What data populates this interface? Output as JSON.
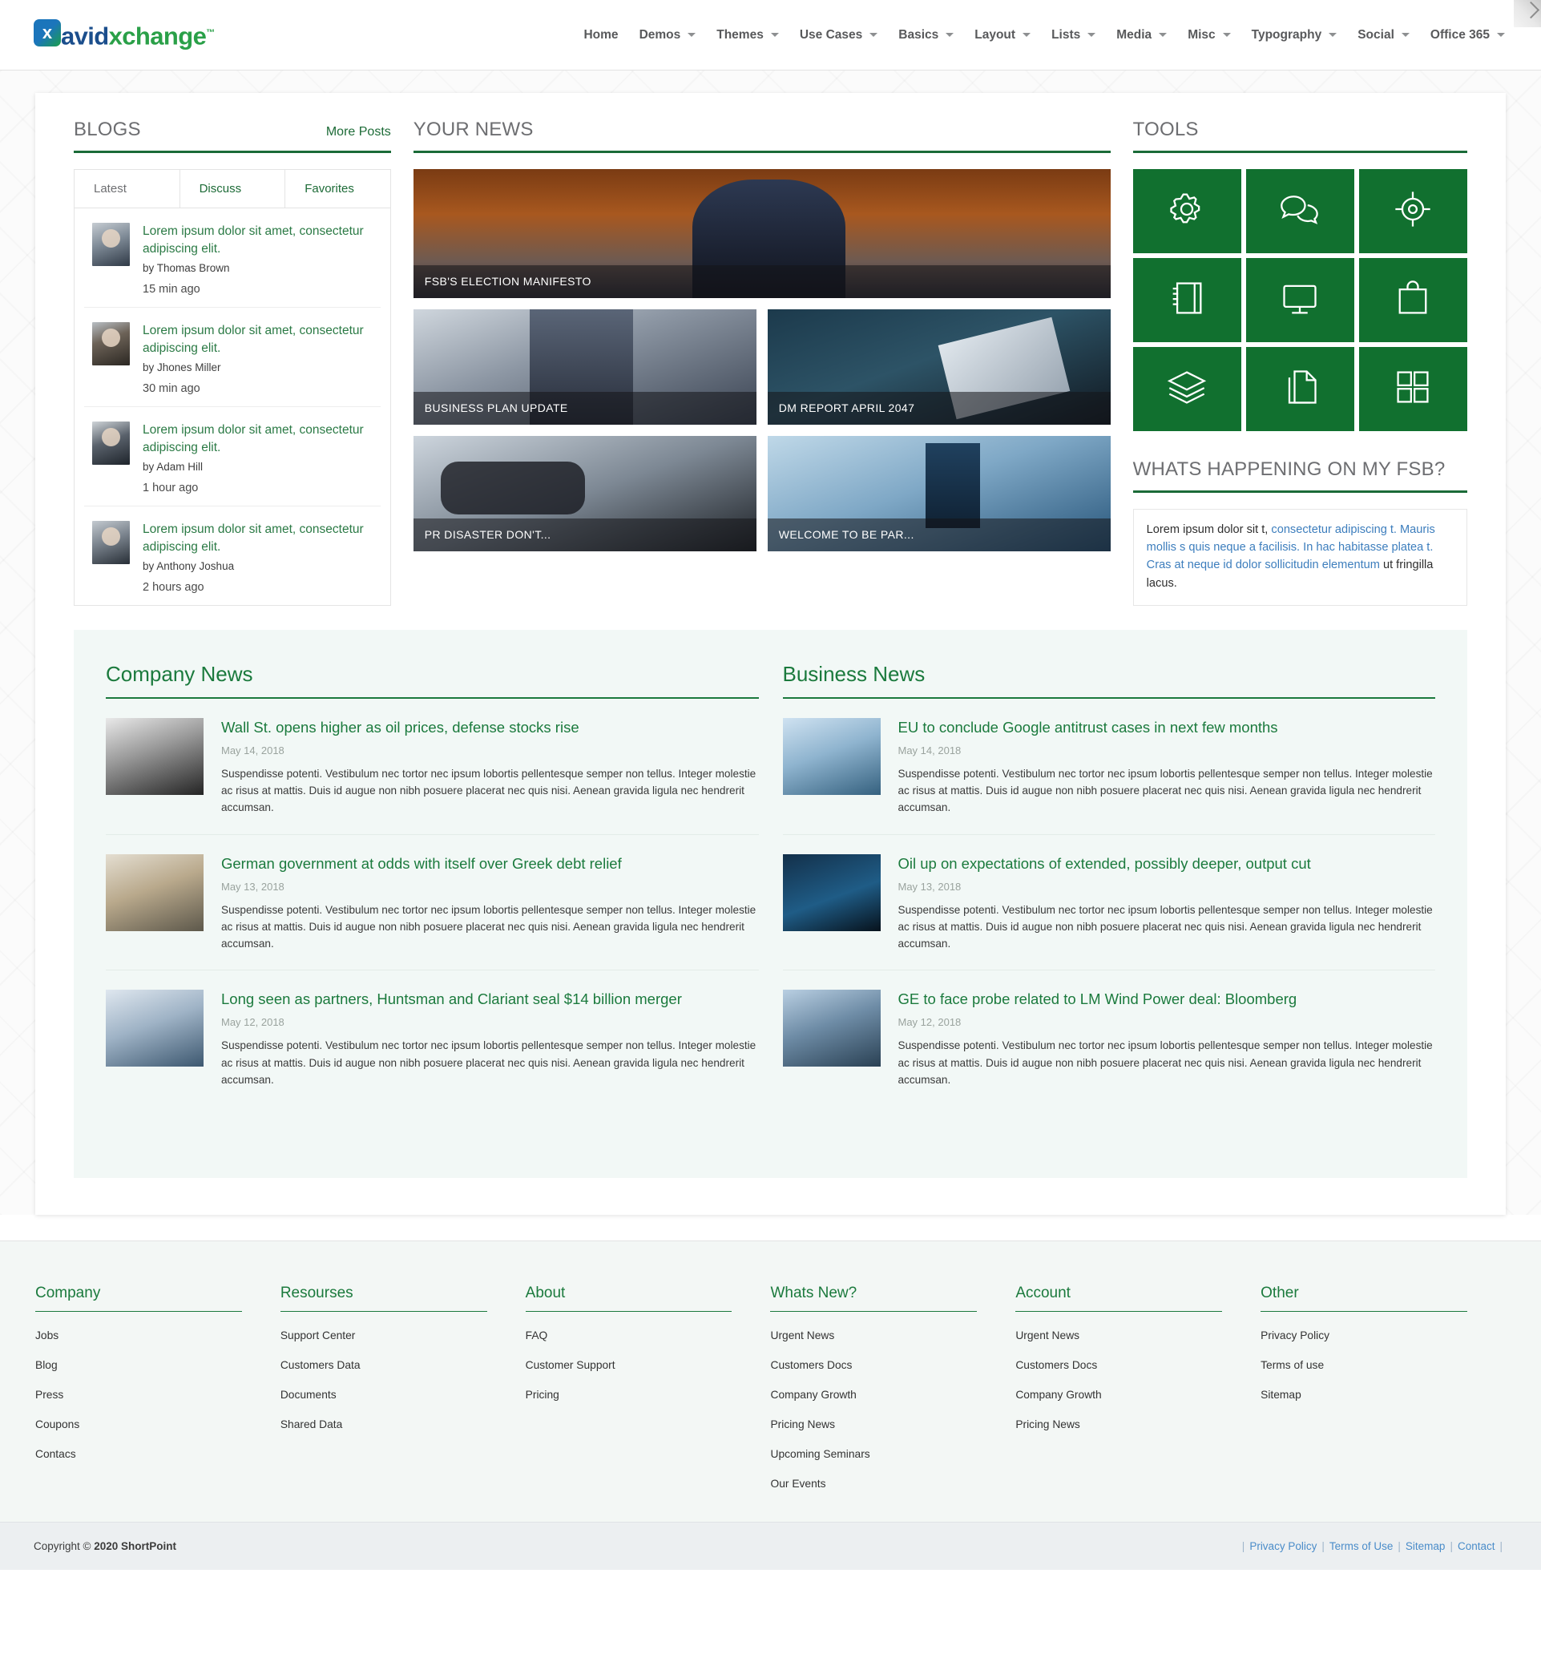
{
  "brand": {
    "mark": "x",
    "name_part1": "avid",
    "name_part2": "xchange",
    "tm": "™"
  },
  "nav": {
    "items": [
      {
        "label": "Home",
        "has_caret": false
      },
      {
        "label": "Demos",
        "has_caret": true
      },
      {
        "label": "Themes",
        "has_caret": true
      },
      {
        "label": "Use Cases",
        "has_caret": true
      },
      {
        "label": "Basics",
        "has_caret": true
      },
      {
        "label": "Layout",
        "has_caret": true
      },
      {
        "label": "Lists",
        "has_caret": true
      },
      {
        "label": "Media",
        "has_caret": true
      },
      {
        "label": "Misc",
        "has_caret": true
      },
      {
        "label": "Typography",
        "has_caret": true
      },
      {
        "label": "Social",
        "has_caret": true
      },
      {
        "label": "Office 365",
        "has_caret": true
      }
    ]
  },
  "blogs": {
    "title": "BLOGS",
    "more_label": "More Posts",
    "tabs": [
      "Latest",
      "Discuss",
      "Favorites"
    ],
    "posts": [
      {
        "title": "Lorem ipsum dolor sit amet, consectetur adipiscing elit.",
        "by": "by Thomas Brown",
        "time": "15 min ago"
      },
      {
        "title": "Lorem ipsum dolor sit amet, consectetur adipiscing elit.",
        "by": "by Jhones Miller",
        "time": "30 min ago"
      },
      {
        "title": "Lorem ipsum dolor sit amet, consectetur adipiscing elit.",
        "by": "by Adam Hill",
        "time": "1 hour ago"
      },
      {
        "title": "Lorem ipsum dolor sit amet, consectetur adipiscing elit.",
        "by": "by Anthony Joshua",
        "time": "2 hours ago"
      }
    ]
  },
  "your_news": {
    "title": "YOUR NEWS",
    "tiles": [
      {
        "caption": "FSB'S ELECTION MANIFESTO"
      },
      {
        "caption": "BUSINESS PLAN UPDATE"
      },
      {
        "caption": "DM REPORT APRIL 2047"
      },
      {
        "caption": "PR DISASTER DON'T..."
      },
      {
        "caption": "WELCOME TO BE PAR..."
      }
    ]
  },
  "tools": {
    "title": "TOOLS",
    "icons": [
      "gear-icon",
      "chat-bubbles-icon",
      "target-icon",
      "notebook-icon",
      "monitor-icon",
      "shopping-bag-icon",
      "layers-icon",
      "documents-icon",
      "grid-icon"
    ]
  },
  "happening": {
    "title": "WHATS HAPPENING ON MY FSB?",
    "text_before": "Lorem ipsum dolor sit t, ",
    "text_link": "consectetur adipiscing t. Mauris mollis s quis neque a facilisis. In hac habitasse platea t. Cras at neque id dolor sollicitudin elementum",
    "text_after": " ut fringilla lacus."
  },
  "company_news": {
    "title": "Company News",
    "articles": [
      {
        "title": "Wall St. opens higher as oil prices, defense stocks rise",
        "date": "May 14, 2018",
        "text": "Suspendisse potenti. Vestibulum nec tortor nec ipsum lobortis pellentesque semper non tellus. Integer molestie ac risus at mattis. Duis id augue non nibh posuere placerat nec quis nisi. Aenean gravida ligula nec hendrerit accumsan."
      },
      {
        "title": "German government at odds with itself over Greek debt relief",
        "date": "May 13, 2018",
        "text": "Suspendisse potenti. Vestibulum nec tortor nec ipsum lobortis pellentesque semper non tellus. Integer molestie ac risus at mattis. Duis id augue non nibh posuere placerat nec quis nisi. Aenean gravida ligula nec hendrerit accumsan."
      },
      {
        "title": "Long seen as partners, Huntsman and Clariant seal $14 billion merger",
        "date": "May 12, 2018",
        "text": "Suspendisse potenti. Vestibulum nec tortor nec ipsum lobortis pellentesque semper non tellus. Integer molestie ac risus at mattis. Duis id augue non nibh posuere placerat nec quis nisi. Aenean gravida ligula nec hendrerit accumsan."
      }
    ]
  },
  "business_news": {
    "title": "Business News",
    "articles": [
      {
        "title": "EU to conclude Google antitrust cases in next few months",
        "date": "May 14, 2018",
        "text": "Suspendisse potenti. Vestibulum nec tortor nec ipsum lobortis pellentesque semper non tellus. Integer molestie ac risus at mattis. Duis id augue non nibh posuere placerat nec quis nisi. Aenean gravida ligula nec hendrerit accumsan."
      },
      {
        "title": "Oil up on expectations of extended, possibly deeper, output cut",
        "date": "May 13, 2018",
        "text": "Suspendisse potenti. Vestibulum nec tortor nec ipsum lobortis pellentesque semper non tellus. Integer molestie ac risus at mattis. Duis id augue non nibh posuere placerat nec quis nisi. Aenean gravida ligula nec hendrerit accumsan."
      },
      {
        "title": "GE to face probe related to LM Wind Power deal: Bloomberg",
        "date": "May 12, 2018",
        "text": "Suspendisse potenti. Vestibulum nec tortor nec ipsum lobortis pellentesque semper non tellus. Integer molestie ac risus at mattis. Duis id augue non nibh posuere placerat nec quis nisi. Aenean gravida ligula nec hendrerit accumsan."
      }
    ]
  },
  "footer": {
    "columns": [
      {
        "title": "Company",
        "links": [
          "Jobs",
          "Blog",
          "Press",
          "Coupons",
          "Contacs"
        ]
      },
      {
        "title": "Resourses",
        "links": [
          "Support Center",
          "Customers Data",
          "Documents",
          "Shared Data"
        ]
      },
      {
        "title": "About",
        "links": [
          "FAQ",
          "Customer Support",
          "Pricing"
        ]
      },
      {
        "title": "Whats New?",
        "links": [
          "Urgent News",
          "Customers Docs",
          "Company Growth",
          "Pricing News",
          "Upcoming Seminars",
          "Our Events"
        ]
      },
      {
        "title": "Account",
        "links": [
          "Urgent News",
          "Customers Docs",
          "Company Growth",
          "Pricing News"
        ]
      },
      {
        "title": "Other",
        "links": [
          "Privacy Policy",
          "Terms of use",
          "Sitemap"
        ]
      }
    ]
  },
  "copyright": {
    "prefix": "Copyright © ",
    "owner": "2020 ShortPoint",
    "links": [
      "Privacy Policy",
      "Terms of Use",
      "Sitemap",
      "Contact"
    ]
  },
  "colors": {
    "brand_green": "#1b6b38",
    "tool_tile_green": "#11702f",
    "link_blue": "#3d7ebd",
    "heading_gray": "#6d6e71"
  }
}
